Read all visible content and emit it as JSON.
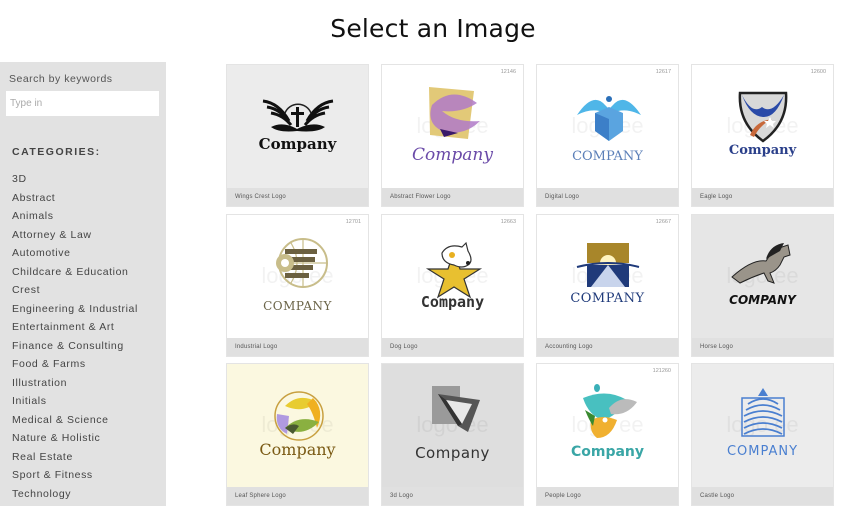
{
  "header": {
    "title": "Select an Image"
  },
  "sidebar": {
    "search_label": "Search by keywords",
    "search_placeholder": "Type in",
    "search_value": "",
    "categories_heading": "CATEGORIES:",
    "categories": [
      "3D",
      "Abstract",
      "Animals",
      "Attorney & Law",
      "Automotive",
      "Childcare & Education",
      "Crest",
      "Engineering & Industrial",
      "Entertainment & Art",
      "Finance & Consulting",
      "Food & Farms",
      "Illustration",
      "Initials",
      "Medical & Science",
      "Nature & Holistic",
      "Real Estate",
      "Sport & Fitness",
      "Technology"
    ]
  },
  "logos": [
    {
      "caption": "Wings Crest Logo",
      "id": "",
      "company": "Company",
      "icon": "wings-crest-icon",
      "bg": "#ececec",
      "text_color": "#111111"
    },
    {
      "caption": "Abstract Flower Logo",
      "id": "12146",
      "company": "Company",
      "icon": "abstract-flower-icon",
      "bg": "#ffffff",
      "text_color": "#6a4aa8"
    },
    {
      "caption": "Digital Logo",
      "id": "12617",
      "company": "COMPANY",
      "icon": "digital-eagle-cube-icon",
      "bg": "#ffffff",
      "text_color": "#5b7fb8"
    },
    {
      "caption": "Eagle Logo",
      "id": "12600",
      "company": "Company",
      "icon": "eagle-shield-icon",
      "bg": "#ffffff",
      "text_color": "#2a3f8a"
    },
    {
      "caption": "Industrial Logo",
      "id": "12701",
      "company": "COMPANY",
      "icon": "industrial-globe-icon",
      "bg": "#ffffff",
      "text_color": "#6b6448"
    },
    {
      "caption": "Dog Logo",
      "id": "12663",
      "company": "Company",
      "icon": "dog-star-icon",
      "bg": "#ffffff",
      "text_color": "#333333"
    },
    {
      "caption": "Accounting Logo",
      "id": "12667",
      "company": "COMPANY",
      "icon": "accounting-pyramid-icon",
      "bg": "#ffffff",
      "text_color": "#1f3a7a"
    },
    {
      "caption": "Horse Logo",
      "id": "",
      "company": "COMPANY",
      "icon": "horse-icon",
      "bg": "#e6e6e6",
      "text_color": "#111111"
    },
    {
      "caption": "Leaf Sphere Logo",
      "id": "",
      "company": "Company",
      "icon": "leaf-sphere-icon",
      "bg": "#fbf8e0",
      "text_color": "#7a5a14"
    },
    {
      "caption": "3d Logo",
      "id": "",
      "company": "Company",
      "icon": "3d-cube-icon",
      "bg": "#dedede",
      "text_color": "#333333"
    },
    {
      "caption": "People Logo",
      "id": "121260",
      "company": "Company",
      "icon": "people-shapes-icon",
      "bg": "#ffffff",
      "text_color": "#3aa6a6"
    },
    {
      "caption": "Castle Logo",
      "id": "",
      "company": "COMPANY",
      "icon": "castle-tower-icon",
      "bg": "#ececec",
      "text_color": "#4a7fd0"
    }
  ],
  "watermark": "logo ee"
}
